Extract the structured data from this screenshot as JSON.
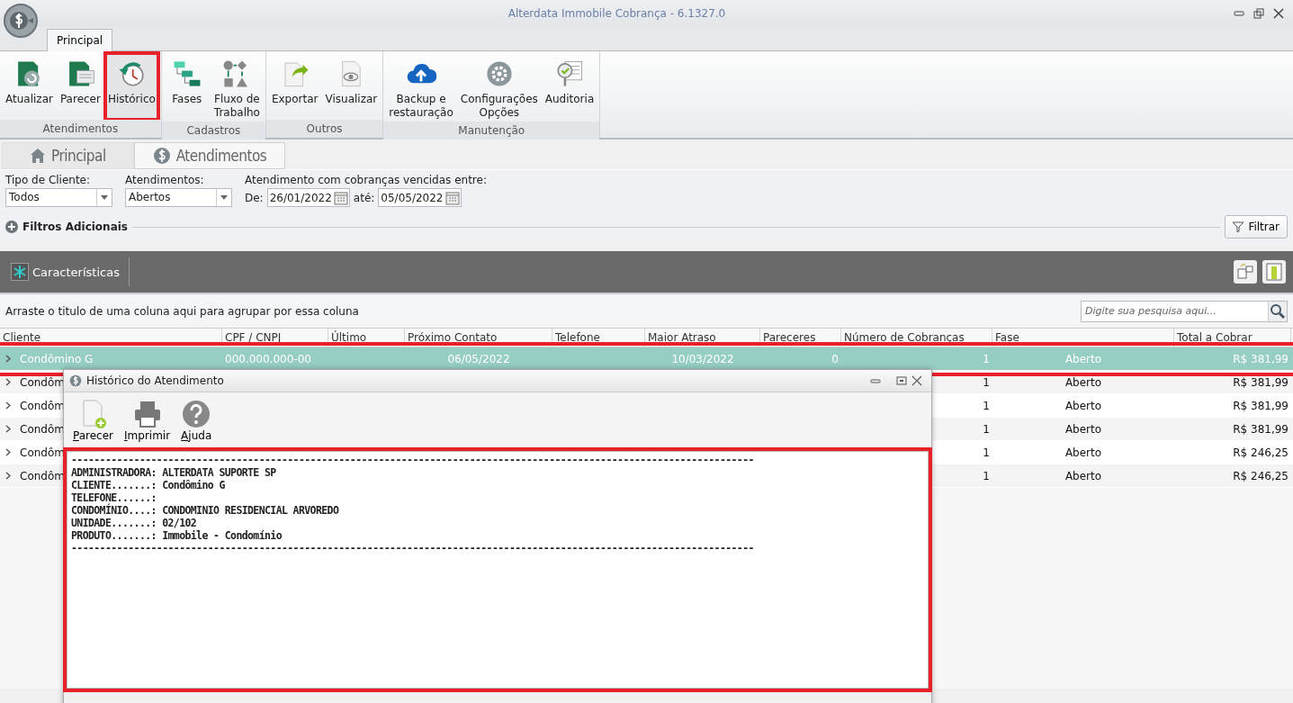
{
  "window": {
    "title": "Alterdata Immobile Cobrança - 6.1327.0"
  },
  "ribbon_tabs": [
    {
      "label": "Principal",
      "selected": true
    }
  ],
  "ribbon_groups": [
    {
      "label": "Atendimentos",
      "buttons": [
        {
          "lines": [
            "Atualizar"
          ],
          "highlighted": false
        },
        {
          "lines": [
            "Parecer"
          ],
          "highlighted": false
        },
        {
          "lines": [
            "Histórico"
          ],
          "highlighted": true
        }
      ]
    },
    {
      "label": "Cadastros",
      "buttons": [
        {
          "lines": [
            "Fases"
          ],
          "highlighted": false
        },
        {
          "lines": [
            "Fluxo de",
            "Trabalho"
          ],
          "highlighted": false
        }
      ]
    },
    {
      "label": "Outros",
      "buttons": [
        {
          "lines": [
            "Exportar"
          ],
          "highlighted": false
        },
        {
          "lines": [
            "Visualizar"
          ],
          "highlighted": false
        }
      ]
    },
    {
      "label": "Manutenção",
      "buttons": [
        {
          "lines": [
            "Backup e",
            "restauração"
          ],
          "highlighted": false
        },
        {
          "lines": [
            "Configurações",
            "Opções"
          ],
          "highlighted": false
        },
        {
          "lines": [
            "Auditoria"
          ],
          "highlighted": false
        }
      ]
    }
  ],
  "doc_tabs": [
    {
      "label": "Principal",
      "selected": false
    },
    {
      "label": "Atendimentos",
      "selected": true
    }
  ],
  "filters": {
    "client_type": {
      "label": "Tipo de Cliente:",
      "value": "Todos"
    },
    "status": {
      "label": "Atendimentos:",
      "value": "Abertos"
    },
    "date_range": {
      "label": "Atendimento com cobranças vencidas entre:",
      "from_label": "De:",
      "from": "26/01/2022",
      "to_label": "até:",
      "to": "05/05/2022"
    },
    "additional": "Filtros Adicionais",
    "filter_button": "Filtrar"
  },
  "toolbar": {
    "characteristics": "Características"
  },
  "group_hint": "Arraste o titulo de uma coluna aqui para agrupar por essa coluna",
  "search": {
    "placeholder": "Digite sua pesquisa aqui..."
  },
  "table": {
    "columns": [
      "Cliente",
      "CPF / CNPJ",
      "Último",
      "Próximo Contato",
      "Telefone",
      "Maior Atraso",
      "Pareceres",
      "Número de Cobranças",
      "Fase",
      "Total a Cobrar"
    ],
    "rows": [
      {
        "selected": true,
        "highlighted": true,
        "cliente": "Condômino G",
        "cpf": "000.000.000-00",
        "proximo": "06/05/2022",
        "atraso": "10/03/2022",
        "pareceres": "0",
        "cobrancas": "1",
        "fase": "Aberto",
        "total": "R$ 381,99"
      },
      {
        "selected": false,
        "highlighted": false,
        "cliente": "Condôm",
        "cobrancas": "1",
        "fase": "Aberto",
        "total": "R$ 381,99"
      },
      {
        "selected": false,
        "highlighted": false,
        "cliente": "Condôm",
        "cobrancas": "1",
        "fase": "Aberto",
        "total": "R$ 381,99"
      },
      {
        "selected": false,
        "highlighted": false,
        "cliente": "Condôm",
        "cobrancas": "1",
        "fase": "Aberto",
        "total": "R$ 381,99"
      },
      {
        "selected": false,
        "highlighted": false,
        "cliente": "Condôm",
        "cobrancas": "1",
        "fase": "Aberto",
        "total": "R$ 246,25"
      },
      {
        "selected": false,
        "highlighted": false,
        "cliente": "Condôm",
        "cobrancas": "1",
        "fase": "Aberto",
        "total": "R$ 246,25"
      }
    ]
  },
  "dialog": {
    "title": "Histórico do Atendimento",
    "buttons": [
      "Parecer",
      "Imprimir",
      "Ajuda"
    ],
    "highlighted": true,
    "lines": [
      "------------------------------------------------------------------------------------------------------------------------",
      "ADMINISTRADORA: ALTERDATA SUPORTE SP",
      "CLIENTE.......: Condômino G",
      "TELEFONE......:",
      "CONDOMÍNIO....: CONDOMINIO RESIDENCIAL ARVOREDO",
      "UNIDADE.......: 02/102",
      "PRODUTO.......: Immobile - Condomínio",
      "------------------------------------------------------------------------------------------------------------------------"
    ]
  }
}
